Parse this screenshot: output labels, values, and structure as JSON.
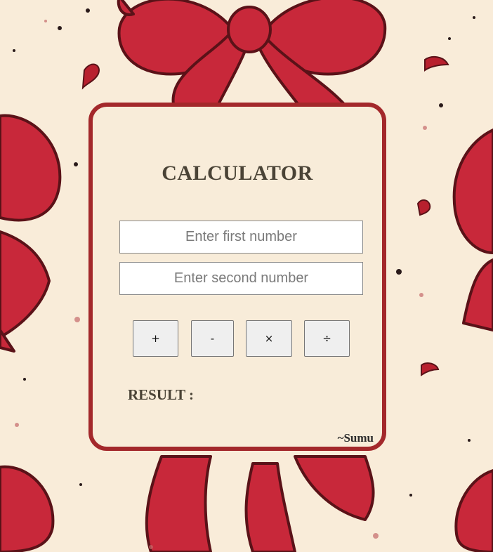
{
  "page": {
    "background_color": "#f9ecd9",
    "ribbon_color": "#c8283a",
    "ribbon_dark": "#5a1218",
    "card_border_color": "#a3282b"
  },
  "calculator": {
    "title": "CALCULATOR",
    "first_input": {
      "placeholder": "Enter first number",
      "value": ""
    },
    "second_input": {
      "placeholder": "Enter second number",
      "value": ""
    },
    "operations": {
      "add": "+",
      "subtract": "-",
      "multiply": "×",
      "divide": "÷"
    },
    "result_label": "RESULT :",
    "result_value": "",
    "signature": "~Sumu"
  },
  "icons": [
    "bow-ribbon-decoration"
  ]
}
